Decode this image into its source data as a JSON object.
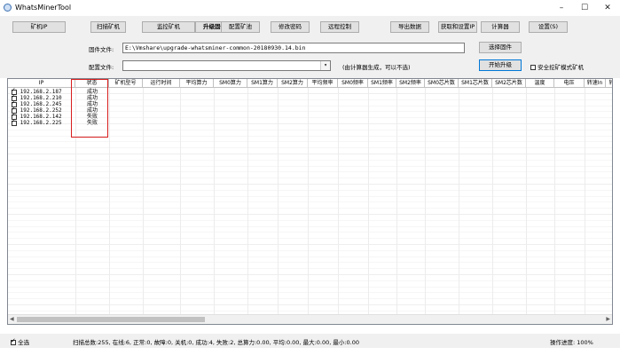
{
  "window": {
    "title": "WhatsMinerTool",
    "controls": {
      "minimize": "–",
      "maximize": "☐",
      "close": "✕"
    }
  },
  "toolbar": {
    "buttons": [
      {
        "label": "矿机IP",
        "active": false
      },
      {
        "label": "扫描矿机",
        "active": false
      },
      {
        "label": "监控矿机",
        "active": false
      },
      {
        "label": "升级固件",
        "active": true
      },
      {
        "label": "配置矿池",
        "active": false
      },
      {
        "label": "修改密码",
        "active": false
      },
      {
        "label": "远程控制",
        "active": false
      },
      {
        "label": "导出数据",
        "active": false
      },
      {
        "label": "获取和设置IP",
        "active": false
      },
      {
        "label": "计算器",
        "active": false
      },
      {
        "label": "设置(S)",
        "active": false
      }
    ]
  },
  "form": {
    "firmware_label": "固件文件:",
    "firmware_value": "E:\\Vmshare\\upgrade-whatsminer-common-20180930.14.bin",
    "select_firmware": "选择固件",
    "config_label": "配置文件:",
    "config_value": "",
    "config_hint": "(由计算器生成，可以不选)",
    "start_upgrade": "开始升级",
    "safe_mode_label": "安全挖矿模式矿机",
    "safe_mode_checked": false
  },
  "table": {
    "columns": [
      "IP",
      "状态",
      "矿机型号",
      "运行时间",
      "平均算力",
      "SM0算力",
      "SM1算力",
      "SM2算力",
      "平均频率",
      "SM0频率",
      "SM1频率",
      "SM2频率",
      "SM0芯片数",
      "SM1芯片数",
      "SM2芯片数",
      "温度",
      "电压",
      "转速In",
      "转"
    ],
    "rows": [
      {
        "ip": "192.168.2.187",
        "status": "成功",
        "checked": true
      },
      {
        "ip": "192.168.2.210",
        "status": "成功",
        "checked": true
      },
      {
        "ip": "192.168.2.245",
        "status": "成功",
        "checked": true
      },
      {
        "ip": "192.168.2.252",
        "status": "成功",
        "checked": true
      },
      {
        "ip": "192.168.2.142",
        "status": "失败",
        "checked": true
      },
      {
        "ip": "192.168.2.225",
        "status": "失败",
        "checked": true
      }
    ]
  },
  "statusbar": {
    "select_all": "全选",
    "select_all_checked": true,
    "summary": "扫描总数:255, 在线:6, 正常:0, 故障:0, 关机:0, 成功:4, 失败:2, 总算力:0.00, 平均:0.00, 最大:0.00, 最小:0.00",
    "progress": "操作进度: 100%"
  },
  "colors": {
    "highlight_box": "#d81e1e",
    "chrome": "#f0f0f0",
    "button": "#e1e1e1"
  }
}
